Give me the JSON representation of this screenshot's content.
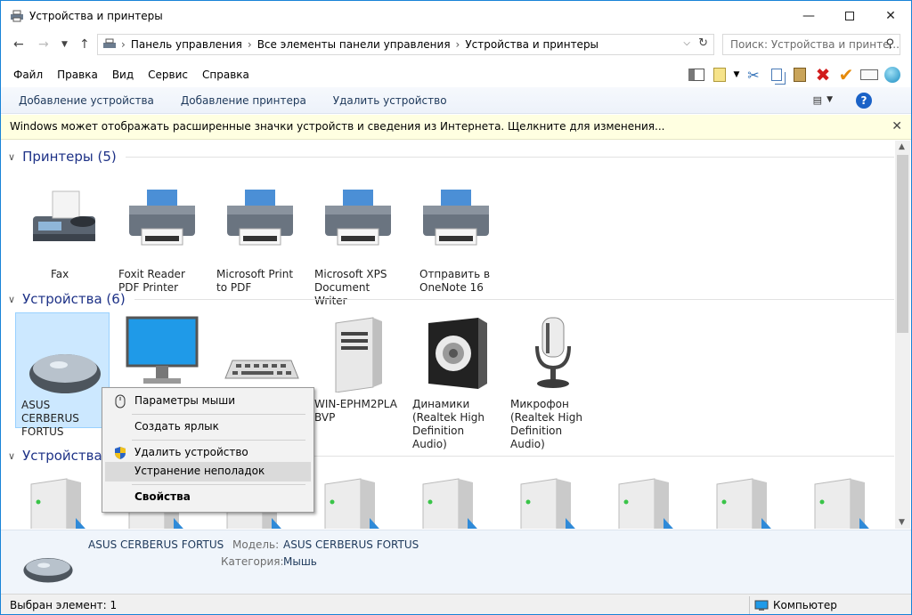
{
  "window": {
    "title": "Устройства и принтеры",
    "controls": [
      "minimize-icon",
      "maximize-icon",
      "close-icon"
    ]
  },
  "address": {
    "crumbs": [
      "Панель управления",
      "Все элементы панели управления",
      "Устройства и принтеры"
    ],
    "search_placeholder": "Поиск: Устройства и принте..."
  },
  "menu": [
    "Файл",
    "Правка",
    "Вид",
    "Сервис",
    "Справка"
  ],
  "commands": [
    "Добавление устройства",
    "Добавление принтера",
    "Удалить устройство"
  ],
  "infobar": "Windows может отображать расширенные значки устройств и сведения из Интернета.  Щелкните для изменения...",
  "groups": {
    "printers": "Принтеры (5)",
    "devices": "Устройства (6)",
    "multimedia": "Устройства м"
  },
  "printers": [
    {
      "label": "Fax",
      "icon": "fax-icon"
    },
    {
      "label": "Foxit Reader PDF Printer",
      "icon": "printer-icon"
    },
    {
      "label": "Microsoft Print to PDF",
      "icon": "printer-icon"
    },
    {
      "label": "Microsoft XPS Document Writer",
      "icon": "printer-icon"
    },
    {
      "label": "Отправить в OneNote 16",
      "icon": "printer-icon"
    }
  ],
  "devices": [
    {
      "label": "ASUS CERBERUS FORTUS",
      "icon": "mouse-icon"
    },
    {
      "label": "",
      "icon": "monitor-icon"
    },
    {
      "label": "",
      "icon": "keyboard-icon"
    },
    {
      "label": "WIN-EPHM2PLA BVP",
      "icon": "computer-tower-icon"
    },
    {
      "label": "Динамики (Realtek High Definition Audio)",
      "icon": "speaker-icon"
    },
    {
      "label": "Микрофон (Realtek High Definition Audio)",
      "icon": "microphone-icon"
    }
  ],
  "context_menu": [
    {
      "label": "Параметры мыши",
      "icon": "mouse-small-icon"
    },
    {
      "label": "Создать ярлык"
    },
    {
      "label": "Удалить устройство",
      "icon": "shield-icon"
    },
    {
      "label": "Устранение неполадок",
      "highlighted": true
    },
    {
      "label": "Свойства",
      "bold": true
    }
  ],
  "details": {
    "name": "ASUS CERBERUS FORTUS",
    "model_label": "Модель:",
    "model_value": "ASUS CERBERUS FORTUS",
    "category_label": "Категория:",
    "category_value": "Мышь"
  },
  "status": {
    "selected": "Выбран элемент: 1",
    "location": "Компьютер"
  }
}
